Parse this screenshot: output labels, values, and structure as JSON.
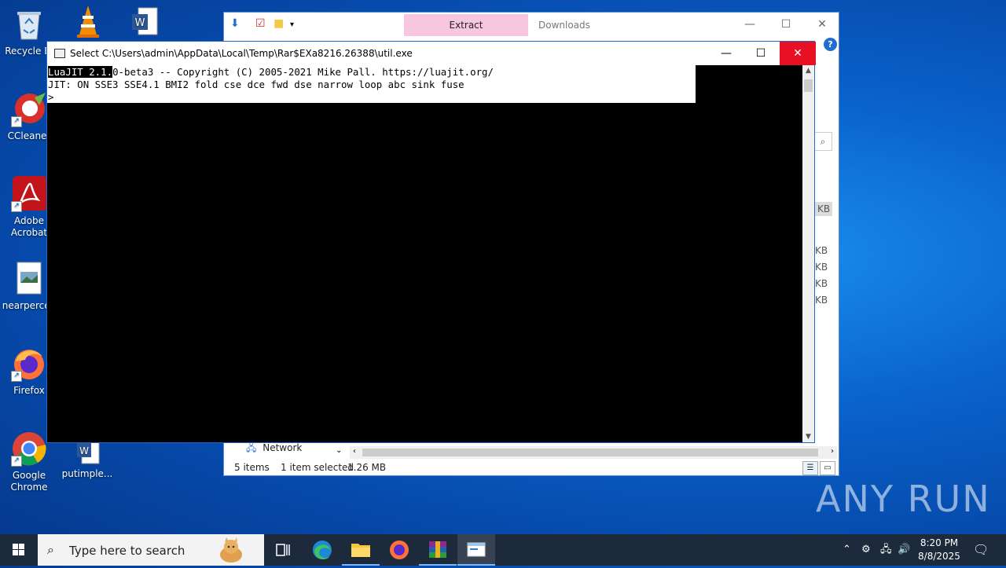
{
  "desktop": {
    "icons": [
      {
        "label": "Recycle Bin",
        "display": "Recycle Bi"
      },
      {
        "label": "CCleaner"
      },
      {
        "label": "Adobe Acrobat",
        "line1": "Adobe",
        "line2": "Acrobat"
      },
      {
        "label": "nearpercen"
      },
      {
        "label": "Firefox"
      },
      {
        "label": "Google Chrome",
        "line1": "Google",
        "line2": "Chrome"
      },
      {
        "label": "putimple..."
      }
    ]
  },
  "explorer": {
    "ribbon_tab_extract": "Extract",
    "ribbon_tab_downloads": "Downloads",
    "nav_network": "Network",
    "sizes": [
      "KB",
      "KB",
      "KB",
      "KB",
      "KB"
    ],
    "status": {
      "items": "5 items",
      "selected": "1 item selected",
      "size": "1.26 MB"
    }
  },
  "console": {
    "title": "Select C:\\Users\\admin\\AppData\\Local\\Temp\\Rar$EXa8216.26388\\util.exe",
    "line1_selected": "LuaJIT 2.1.",
    "line1_rest": "0-beta3 -- Copyright (C) 2005-2021 Mike Pall. https://luajit.org/",
    "line2": "JIT: ON SSE3 SSE4.1 BMI2 fold cse dce fwd dse narrow loop abc sink fuse",
    "line3": ">"
  },
  "taskbar": {
    "search_placeholder": "Type here to search",
    "time": "8:20 PM",
    "date": "8/8/2025"
  },
  "watermark": "ANY RUN"
}
